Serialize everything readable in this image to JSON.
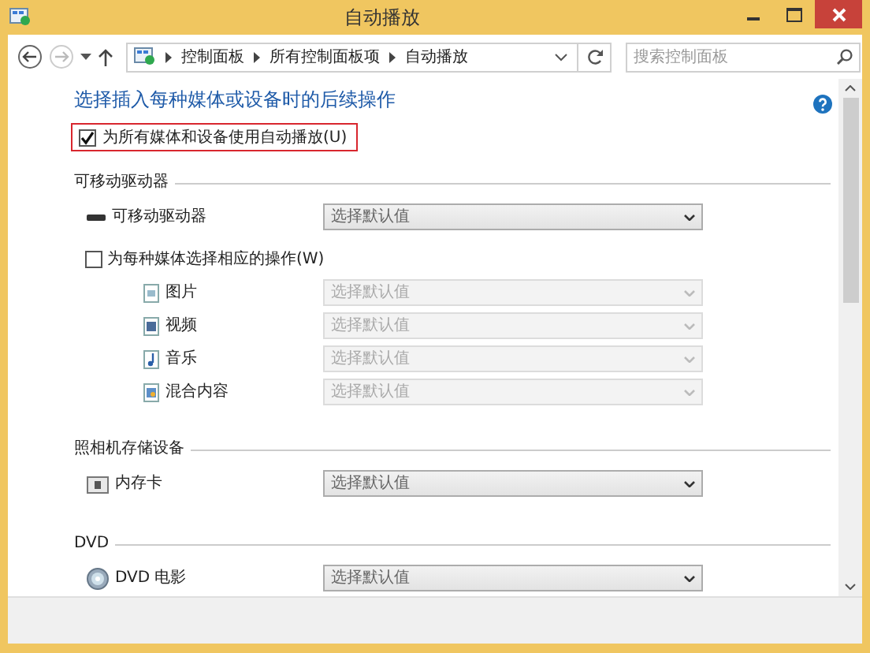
{
  "window": {
    "title": "自动播放"
  },
  "address_bar": {
    "breadcrumbs": [
      "控制面板",
      "所有控制面板项",
      "自动播放"
    ]
  },
  "search": {
    "placeholder": "搜索控制面板"
  },
  "heading": "选择插入每种媒体或设备时的后续操作",
  "autoplay_all": {
    "label": "为所有媒体和设备使用自动播放(U)",
    "checked": true
  },
  "sections": [
    {
      "title": "可移动驱动器",
      "items": [
        {
          "kind": "drive",
          "label": "可移动驱动器",
          "value": "选择默认值",
          "disabled": false
        },
        {
          "kind": "option",
          "label": "为每种媒体选择相应的操作(W)",
          "checked": false,
          "children": [
            {
              "kind": "pictures",
              "label": "图片",
              "value": "选择默认值",
              "disabled": true
            },
            {
              "kind": "video",
              "label": "视频",
              "value": "选择默认值",
              "disabled": true
            },
            {
              "kind": "music",
              "label": "音乐",
              "value": "选择默认值",
              "disabled": true
            },
            {
              "kind": "mixed",
              "label": "混合内容",
              "value": "选择默认值",
              "disabled": true
            }
          ]
        }
      ]
    },
    {
      "title": "照相机存储设备",
      "items": [
        {
          "kind": "card",
          "label": "内存卡",
          "value": "选择默认值",
          "disabled": false
        }
      ]
    },
    {
      "title": "DVD",
      "items": [
        {
          "kind": "dvd",
          "label": "DVD 电影",
          "value": "选择默认值",
          "disabled": false
        }
      ]
    }
  ]
}
